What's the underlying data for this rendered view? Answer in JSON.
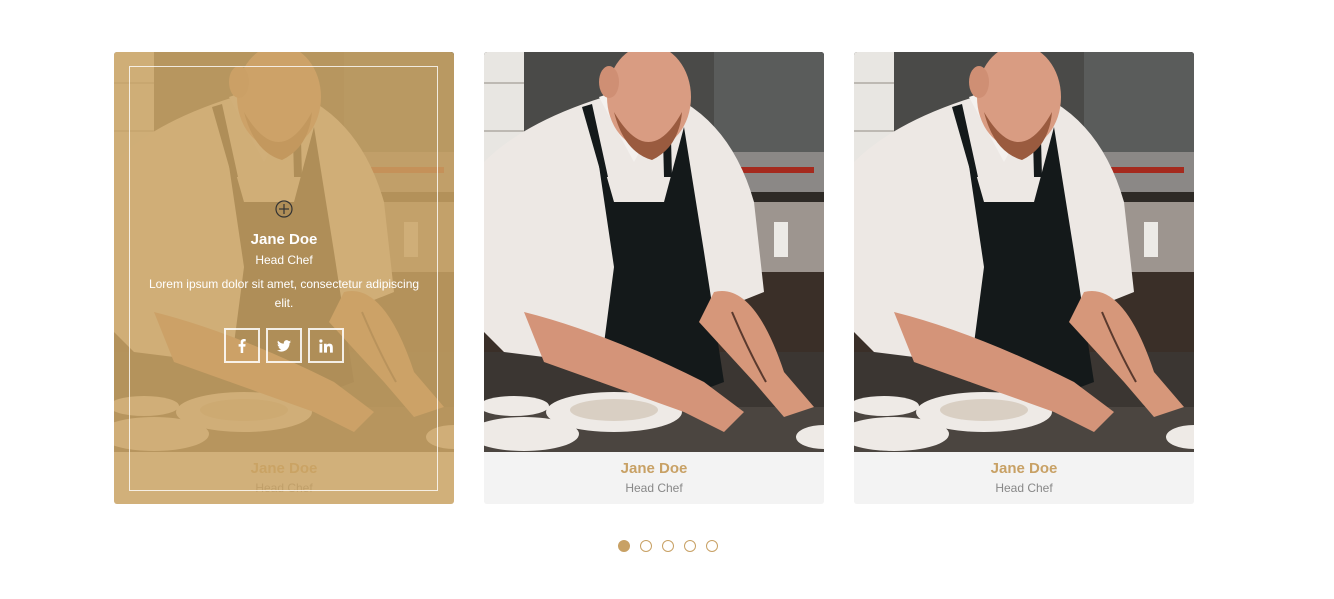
{
  "colors": {
    "accent": "#c8a165",
    "overlay": "rgba(202,163,100,0.85)",
    "caption_bg": "#f3f3f3",
    "role_text": "#888888"
  },
  "team": [
    {
      "name": "Jane Doe",
      "role": "Head Chef",
      "description": "Lorem ipsum dolor sit amet, consectetur adipiscing elit.",
      "photo_icon": "chef-photo",
      "hovered": true,
      "social": [
        {
          "icon": "facebook-icon",
          "label": "f"
        },
        {
          "icon": "twitter-icon",
          "label": "twitter"
        },
        {
          "icon": "linkedin-icon",
          "label": "in"
        }
      ]
    },
    {
      "name": "Jane Doe",
      "role": "Head Chef",
      "photo_icon": "chef-photo",
      "hovered": false
    },
    {
      "name": "Jane Doe",
      "role": "Head Chef",
      "photo_icon": "chef-photo",
      "hovered": false
    }
  ],
  "pagination": {
    "count": 5,
    "active_index": 0
  }
}
